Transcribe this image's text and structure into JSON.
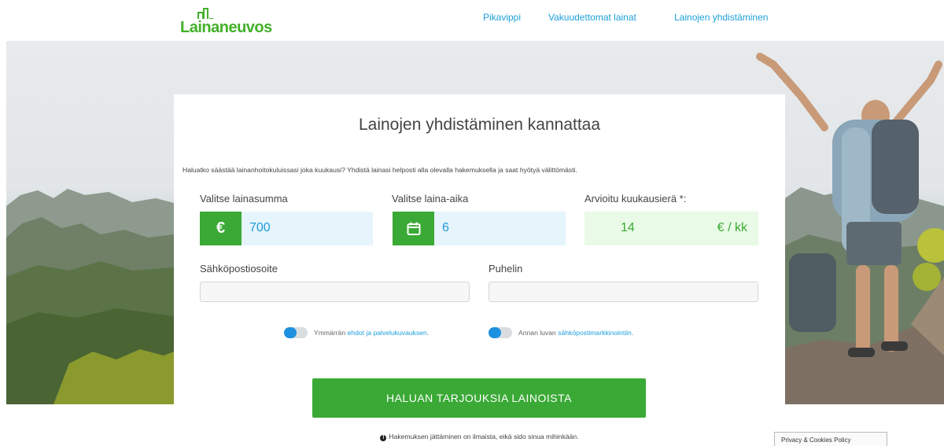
{
  "brand": {
    "logo_text": "Lainaneuvos",
    "accent_color": "#43b02a",
    "link_color": "#1ea0db"
  },
  "nav": {
    "items": [
      {
        "label": "Pikavippi"
      },
      {
        "label": "Vakuudettomat lainat"
      },
      {
        "label": "Lainojen yhdistäminen"
      }
    ]
  },
  "form": {
    "title": "Lainojen yhdistäminen kannattaa",
    "intro": "Haluatko säästää lainanhoitokuluissasi joka kuukausi? Yhdistä lainasi helposti alla olevalla hakemuksella ja saat hyötyä välittömästi.",
    "amount": {
      "label": "Valitse lainasumma",
      "icon": "euro-icon",
      "icon_glyph": "€",
      "value": "700"
    },
    "term": {
      "label": "Valitse laina-aika",
      "icon": "calendar-icon",
      "value": "6"
    },
    "monthly": {
      "label": "Arvioitu kuukausierä *:",
      "value": "14",
      "unit": "€ / kk"
    },
    "email": {
      "label": "Sähköpostiosoite",
      "value": ""
    },
    "phone": {
      "label": "Puhelin",
      "value": ""
    },
    "terms_toggle": {
      "text": "Ymmärrän",
      "link": "ehdot ja palvelukuvauksen",
      "suffix": ".",
      "checked": true
    },
    "marketing_toggle": {
      "text": "Annan luvan",
      "link": "sähköpostimarkkinointiin",
      "suffix": ".",
      "checked": true
    },
    "submit_label": "HALUAN TARJOUKSIA LAINOISTA",
    "footnote": "Hakemuksen jättäminen on ilmaista, eikä sido sinua mihinkään."
  },
  "privacy_badge": "Privacy & Cookies Policy"
}
